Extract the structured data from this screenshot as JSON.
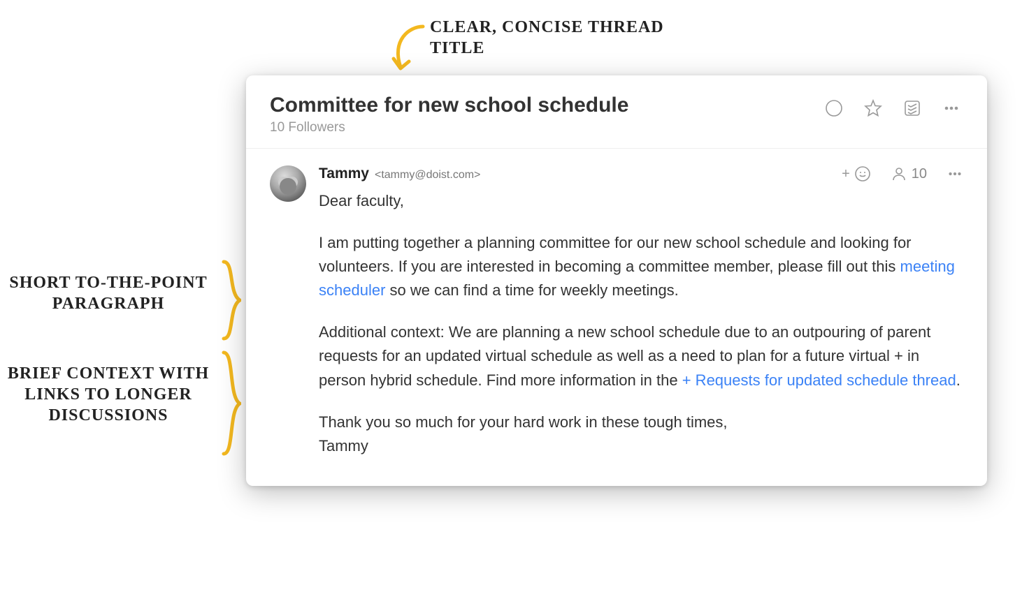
{
  "annotations": {
    "top": "Clear, concise thread title",
    "left1": "Short to-the-point paragraph",
    "left2": "Brief context with links to longer discussions"
  },
  "thread": {
    "title": "Committee for new school schedule",
    "followers_label": "10 Followers"
  },
  "message": {
    "author_name": "Tammy",
    "author_email": "<tammy@doist.com>",
    "followers_count": "10",
    "greeting": "Dear faculty,",
    "p1_before": "I am putting together a planning committee for our new school schedule and looking for volunteers. If you are interested in becoming a committee member, please fill out this ",
    "p1_link": "meeting scheduler",
    "p1_after": " so we can find a time for weekly meetings.",
    "p2_before": "Additional context: We are planning a new school schedule due to an outpouring of parent requests for an updated virtual schedule as well as a need to plan for a future virtual + in person hybrid schedule. Find more information in the ",
    "p2_link": "+ Requests for updated schedule thread",
    "p2_after": ".",
    "signoff1": "Thank you so much for your hard work in these tough times,",
    "signoff2": "Tammy"
  }
}
